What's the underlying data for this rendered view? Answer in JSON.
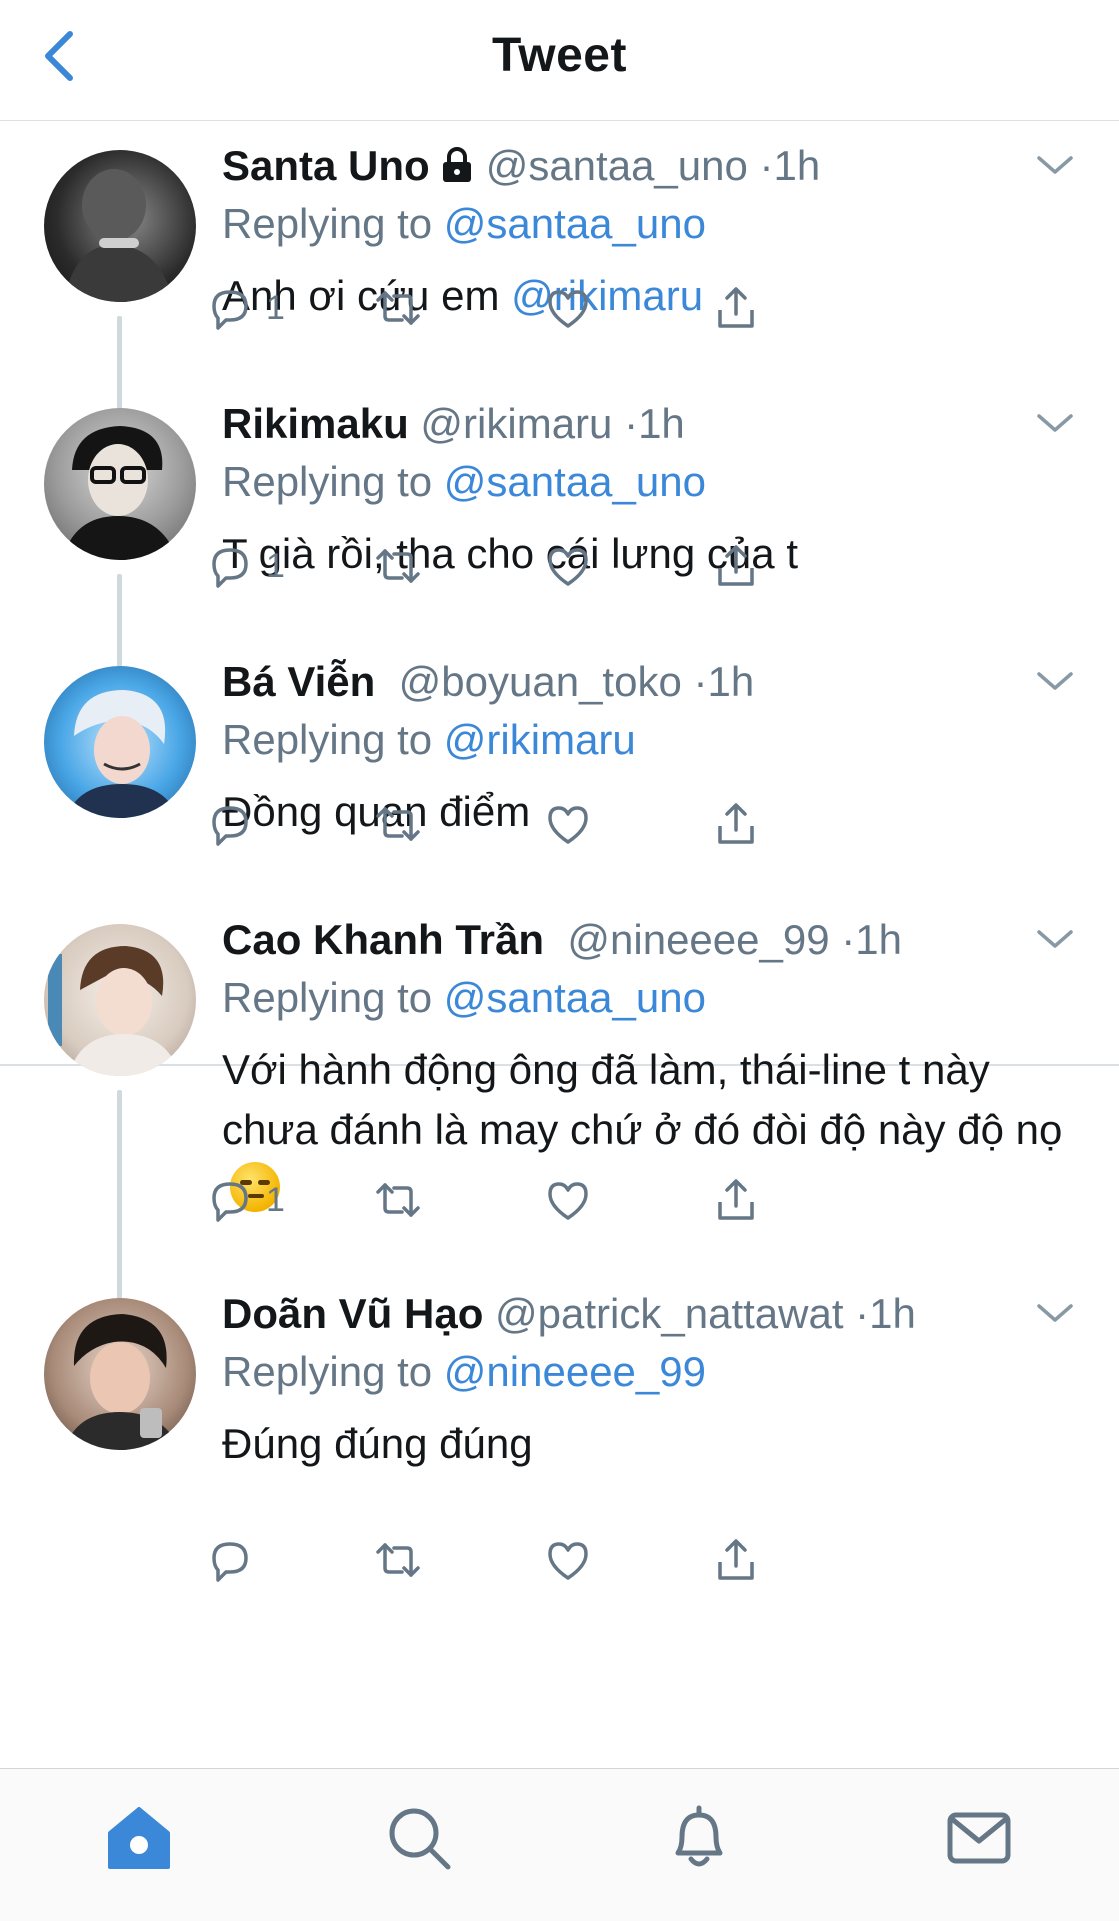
{
  "header": {
    "title": "Tweet",
    "back_icon": "chevron-left-icon",
    "accent": "#3b88d8"
  },
  "tweets": [
    {
      "name": "Santa Uno",
      "locked": true,
      "handle": "@santaa_uno",
      "dot": "·",
      "time": "1h",
      "replying_prefix": "Replying to",
      "replying_to": "@santaa_uno",
      "body": "Anh ơi cứu em ",
      "body_mention": "@rikimaru",
      "reply_count": "1"
    },
    {
      "name": "Rikimaku",
      "handle": "@rikimaru",
      "dot": "·",
      "time": "1h",
      "replying_prefix": "Replying to",
      "replying_to": "@santaa_uno",
      "body": "T già rồi, tha cho cái lưng của t",
      "reply_count": "1"
    },
    {
      "name": "Bá Viễn",
      "handle": "@boyuan_toko",
      "dot": "·",
      "time": "1h",
      "replying_prefix": "Replying to",
      "replying_to": "@rikimaru",
      "body": "Đồng quan điểm",
      "reply_count": ""
    },
    {
      "name": "Cao Khanh Trần",
      "handle": "@nineeee_99",
      "dot": "·",
      "time": "1h",
      "replying_prefix": "Replying to",
      "replying_to": "@santaa_uno",
      "body": "Với hành động ông đã làm, thái-line t này chưa đánh là may chứ ở đó đòi độ này độ nọ",
      "emoji": "unamused-face-emoji",
      "reply_count": "1"
    },
    {
      "name": "Doãn Vũ Hạo",
      "handle": "@patrick_nattawat",
      "dot": "·",
      "time": "1h",
      "replying_prefix": "Replying to",
      "replying_to": "@nineeee_99",
      "body": "Đúng đúng đúng",
      "reply_count": ""
    }
  ],
  "tabbar": {
    "items": [
      "home-icon",
      "search-icon",
      "notifications-icon",
      "messages-icon"
    ],
    "active": "home-icon"
  }
}
